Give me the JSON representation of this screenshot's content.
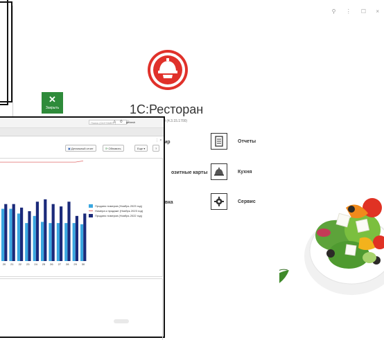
{
  "main": {
    "window_controls": "⚲ ⋮ ☐ ×",
    "close_tile_label": "Закрыть",
    "app_title": "1С:Ресторан",
    "version": "1.0 (4.3.15.1700)",
    "menu_left": [
      "ир",
      "озитные карты",
      "авка"
    ],
    "menu_right": [
      "Отчеты",
      "Кухня",
      "Сервис"
    ],
    "icons": [
      "report-icon",
      "cloche-icon",
      "gear-icon"
    ],
    "brand_color": "#e0312a",
    "close_color": "#2e8b3a"
  },
  "report": {
    "search_placeholder": "Поиск (Ctrl+Shift+F)",
    "user": "gebesh",
    "title_icons": "⚠ ⏱ ☆",
    "panel_controls": "⋮ ×",
    "btn_detail": "Детальный отчет",
    "btn_refresh": "Обновить",
    "btn_more": "Еще ▾",
    "btn_help": "?"
  },
  "chart_data": {
    "type": "bar",
    "categories": [
      "20",
      "21",
      "22",
      "23",
      "24",
      "25",
      "26",
      "27",
      "28",
      "29",
      "30"
    ],
    "series": [
      {
        "name": "Продано номеров (Ноябрь 2023 год)",
        "values": [
          44,
          44,
          40,
          32,
          38,
          33,
          32,
          32,
          32,
          32,
          31
        ],
        "color": "#3aa7e0"
      },
      {
        "name": "Номера к продаже (Ноябрь 2023 год)",
        "values": [
          60,
          60,
          60,
          60,
          60,
          60,
          60,
          60,
          60,
          60,
          61
        ],
        "color": "#e06a6a"
      },
      {
        "name": "Продано номеров (Ноябрь 2022 год)",
        "values": [
          48,
          48,
          45,
          42,
          50,
          52,
          48,
          46,
          50,
          38,
          40
        ],
        "color": "#1b2a7a"
      }
    ],
    "legend_position": "right"
  }
}
